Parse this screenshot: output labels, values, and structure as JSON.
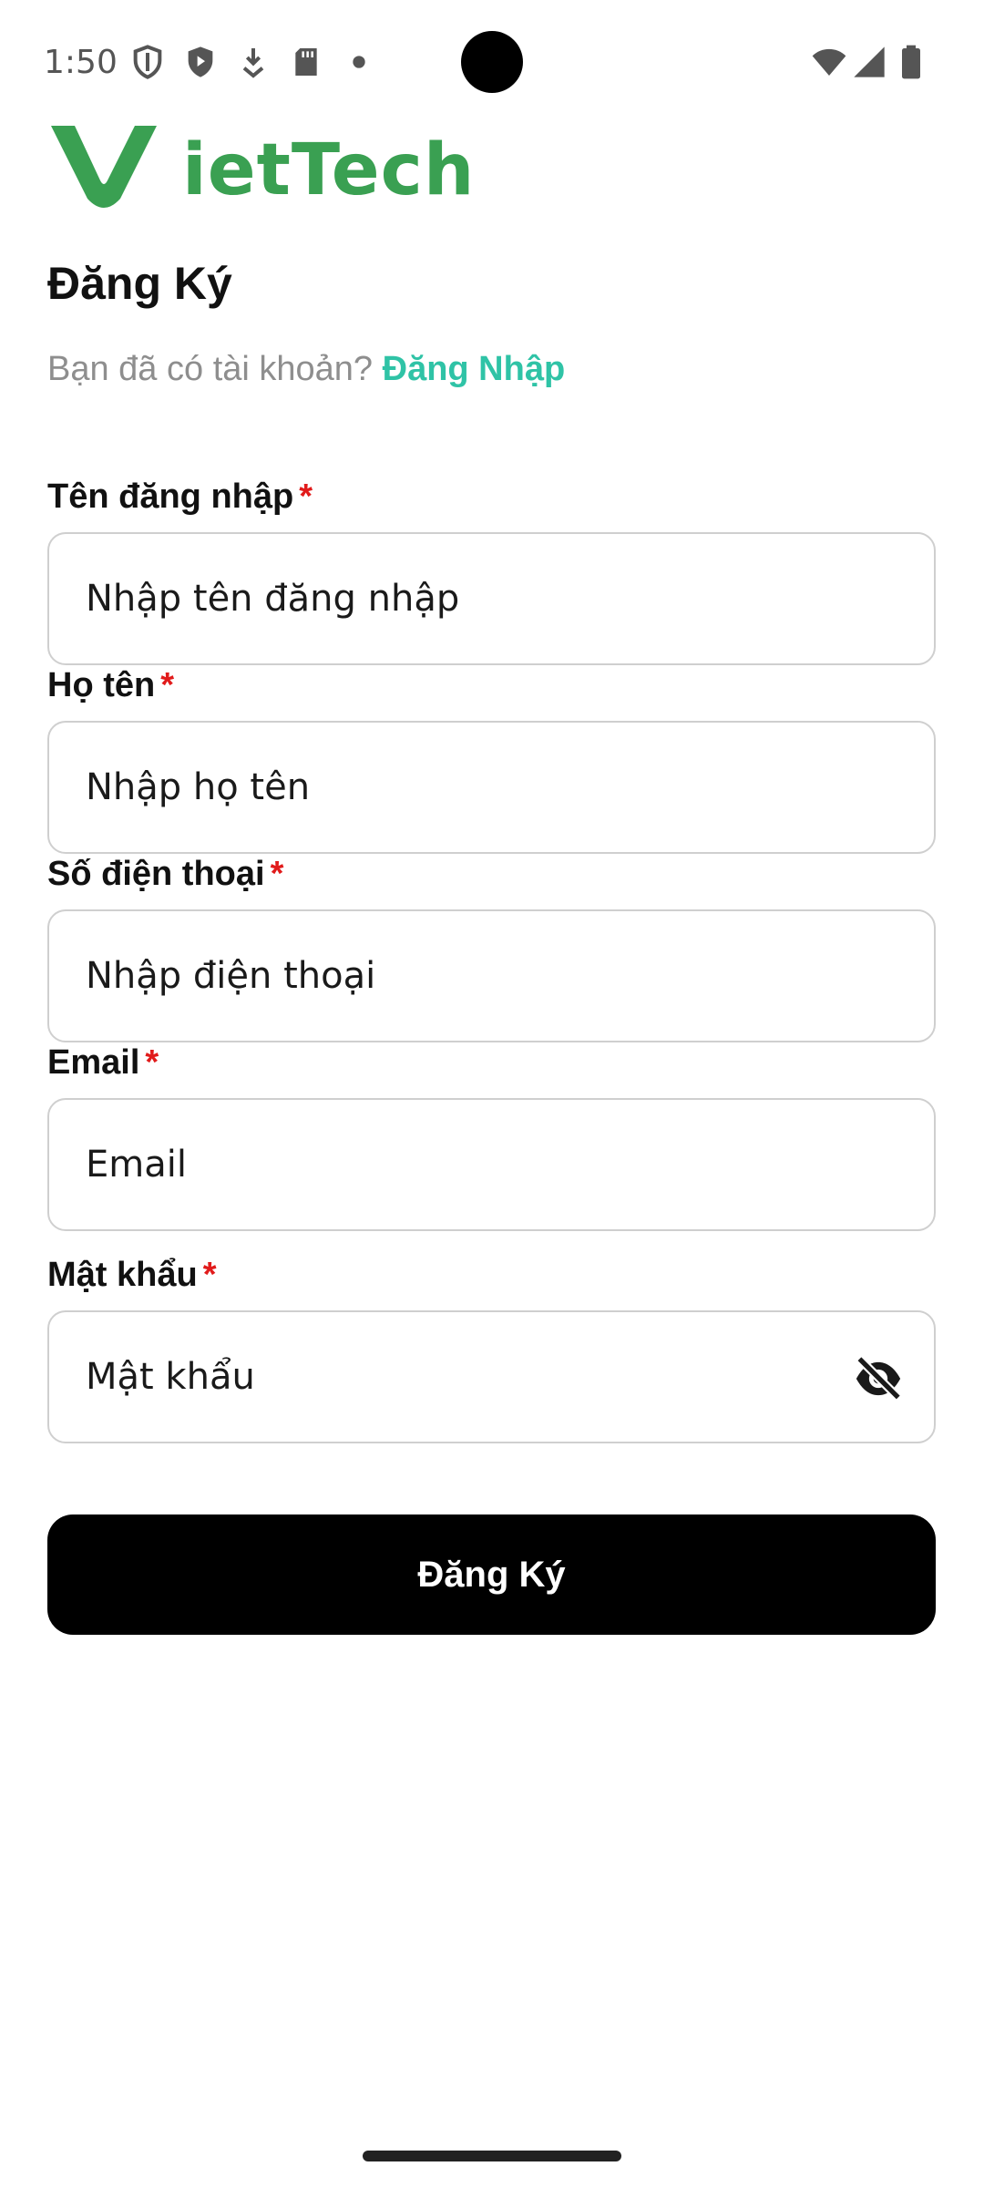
{
  "status_bar": {
    "time": "1:50",
    "icons": [
      "shield-outline-icon",
      "shield-play-icon",
      "download-icon",
      "sd-card-icon",
      "dot-icon",
      "wifi-icon",
      "signal-icon",
      "battery-icon"
    ]
  },
  "brand": {
    "name": "ietTech",
    "color": "#3aa052"
  },
  "page": {
    "title": "Đăng Ký",
    "has_account_text": "Bạn đã có tài khoản?",
    "login_link": "Đăng Nhập",
    "link_color": "#2fc3a6"
  },
  "form": {
    "required_mark": "*",
    "username": {
      "label": "Tên đăng nhập",
      "placeholder": "Nhập tên đăng nhập",
      "value": ""
    },
    "fullname": {
      "label": "Họ tên",
      "placeholder": "Nhập họ tên",
      "value": ""
    },
    "phone": {
      "label": "Số điện thoại",
      "placeholder": "Nhập điện thoại",
      "value": ""
    },
    "email": {
      "label": "Email",
      "placeholder": "Email",
      "value": ""
    },
    "password": {
      "label": "Mật khẩu",
      "placeholder": "Mật khẩu",
      "value": "",
      "toggle_icon": "eye-off-icon"
    },
    "submit_label": "Đăng Ký"
  }
}
